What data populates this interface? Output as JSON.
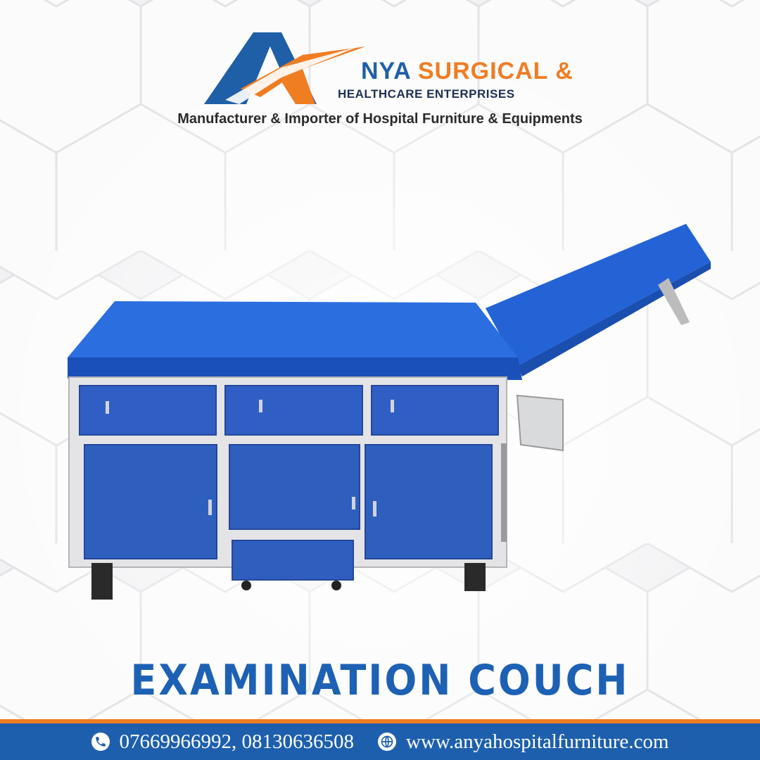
{
  "brand": {
    "logo_letter": "A",
    "name_main": "NYA",
    "name_rest": " SURGICAL &",
    "name_sub": "HEALTHCARE ENTERPRISES",
    "tagline": "Manufacturer & Importer of Hospital Furniture & Equipments",
    "colors": {
      "blue": "#1f5fa8",
      "orange": "#ef7d22",
      "navy": "#1e2f55"
    }
  },
  "product": {
    "title": "EXAMINATION COUCH",
    "colors": {
      "upholstery": "#1f5fc8",
      "frame": "#e6e6e6",
      "panels": "#2e5fbf"
    }
  },
  "footer": {
    "phone_icon": "phone-icon",
    "phones": "07669966992, 08130636508",
    "web_icon": "globe-icon",
    "website": "www.anyahospitalfurniture.com",
    "colors": {
      "bar": "#1d5fad",
      "accent_line": "#ef7d22"
    }
  }
}
